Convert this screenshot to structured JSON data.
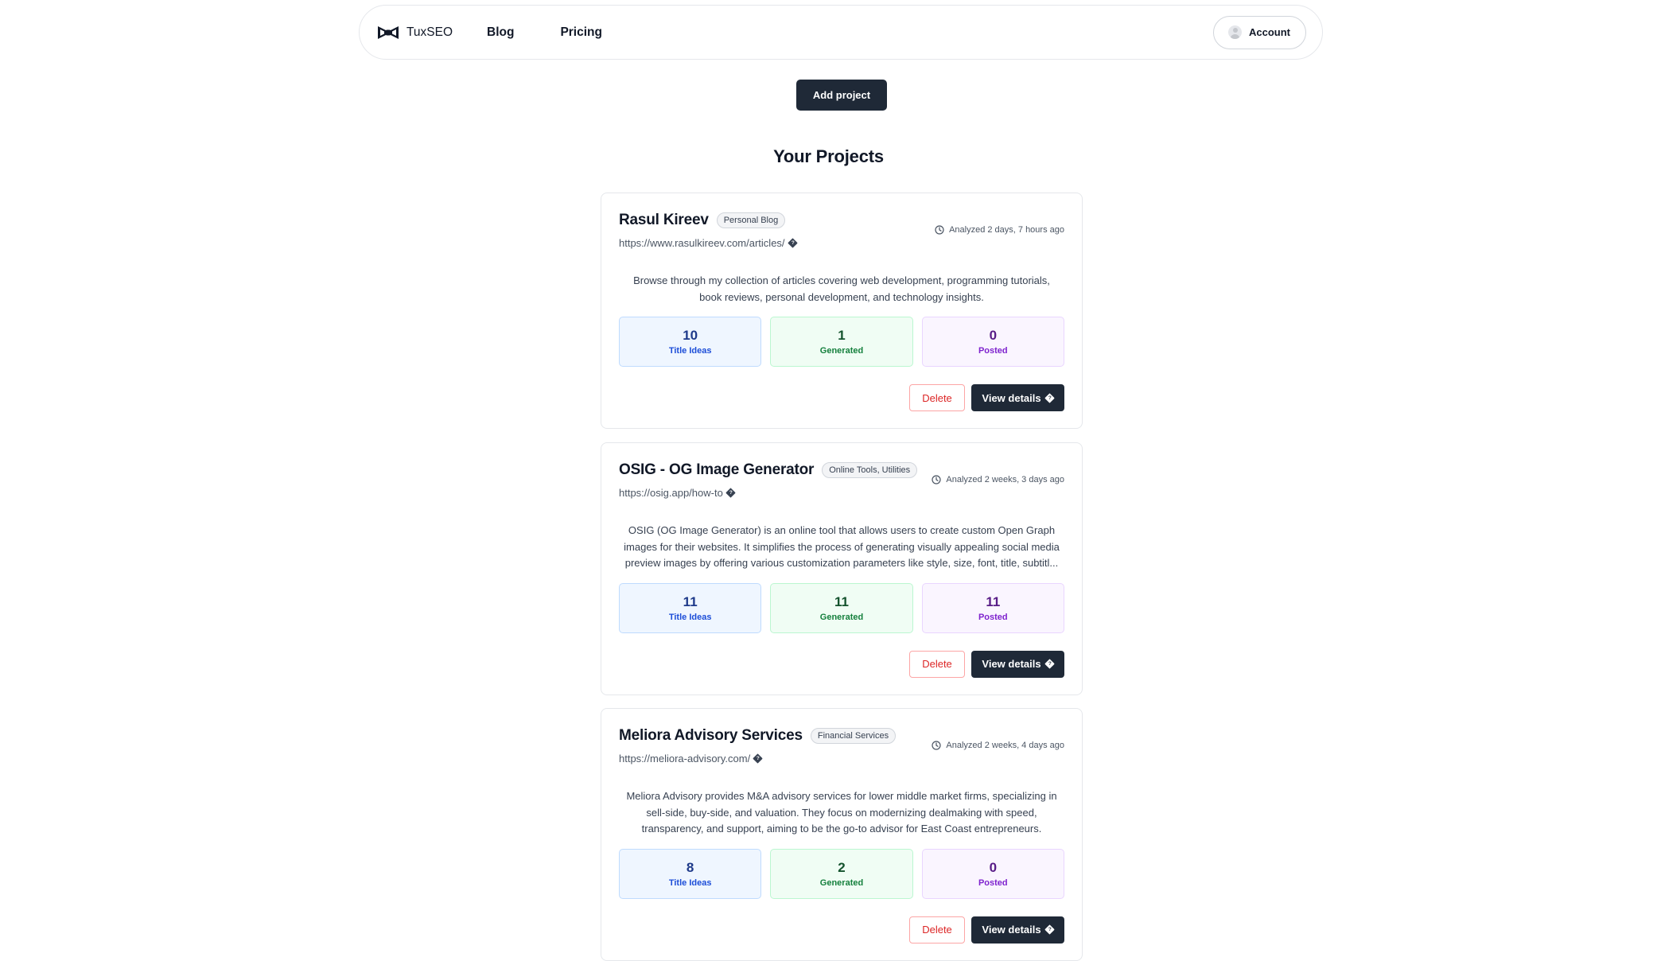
{
  "nav": {
    "brand": "TuxSEO",
    "links": [
      "Blog",
      "Pricing"
    ],
    "account_label": "Account"
  },
  "add_project_label": "Add project",
  "page_title": "Your Projects",
  "stat_labels": {
    "ideas": "Title Ideas",
    "generated": "Generated",
    "posted": "Posted"
  },
  "actions": {
    "delete": "Delete",
    "view": "View details"
  },
  "projects": [
    {
      "name": "Rasul Kireev",
      "tag": "Personal Blog",
      "url": "https://www.rasulkireev.com/articles/",
      "analyzed": "Analyzed 2 days, 7 hours ago",
      "description": "Browse through my collection of articles covering web development, programming tutorials, book reviews, personal development, and technology insights.",
      "title_ideas": "10",
      "generated": "1",
      "posted": "0"
    },
    {
      "name": "OSIG - OG Image Generator",
      "tag": "Online Tools, Utilities",
      "url": "https://osig.app/how-to",
      "analyzed": "Analyzed 2 weeks, 3 days ago",
      "description": "OSIG (OG Image Generator) is an online tool that allows users to create custom Open Graph images for their websites. It simplifies the process of generating visually appealing social media preview images by offering various customization parameters like style, size, font, title, subtitl...",
      "title_ideas": "11",
      "generated": "11",
      "posted": "11"
    },
    {
      "name": "Meliora Advisory Services",
      "tag": "Financial Services",
      "url": "https://meliora-advisory.com/",
      "analyzed": "Analyzed 2 weeks, 4 days ago",
      "description": "Meliora Advisory provides M&A advisory services for lower middle market firms, specializing in sell-side, buy-side, and valuation. They focus on modernizing dealmaking with speed, transparency, and support, aiming to be the go-to advisor for East Coast entrepreneurs.",
      "title_ideas": "8",
      "generated": "2",
      "posted": "0"
    }
  ]
}
